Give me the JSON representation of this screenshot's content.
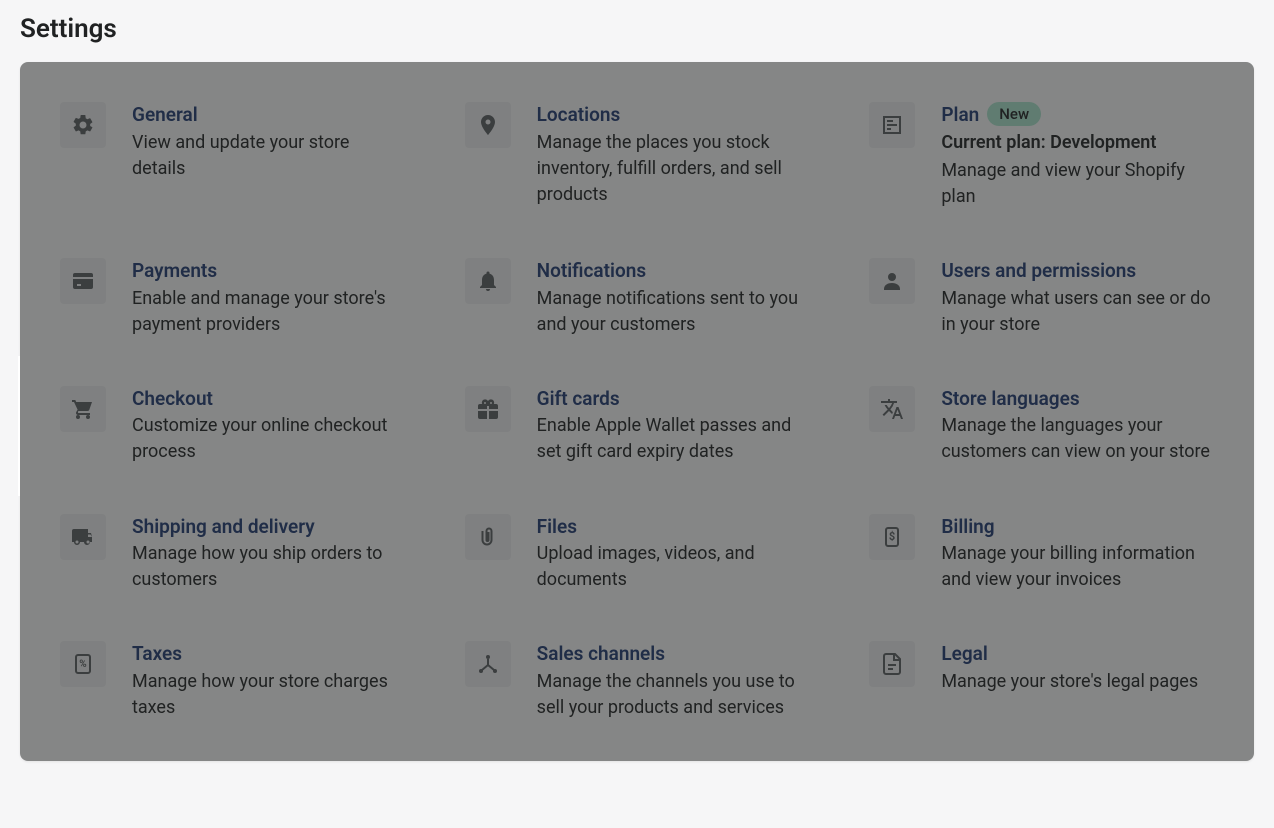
{
  "pageTitle": "Settings",
  "highlightId": "checkout",
  "cards": [
    {
      "id": "general",
      "title": "General",
      "desc": "View and update your store details"
    },
    {
      "id": "locations",
      "title": "Locations",
      "desc": "Manage the places you stock inventory, fulfill orders, and sell products"
    },
    {
      "id": "plan",
      "title": "Plan",
      "badge": "New",
      "extra": "Current plan: Development",
      "desc": "Manage and view your Shopify plan"
    },
    {
      "id": "payments",
      "title": "Payments",
      "desc": "Enable and manage your store's payment providers"
    },
    {
      "id": "notifications",
      "title": "Notifications",
      "desc": "Manage notifications sent to you and your customers"
    },
    {
      "id": "users",
      "title": "Users and permissions",
      "desc": "Manage what users can see or do in your store"
    },
    {
      "id": "checkout",
      "title": "Checkout",
      "desc": "Customize your online checkout process"
    },
    {
      "id": "giftcards",
      "title": "Gift cards",
      "desc": "Enable Apple Wallet passes and set gift card expiry dates"
    },
    {
      "id": "languages",
      "title": "Store languages",
      "desc": "Manage the languages your customers can view on your store"
    },
    {
      "id": "shipping",
      "title": "Shipping and delivery",
      "desc": "Manage how you ship orders to customers"
    },
    {
      "id": "files",
      "title": "Files",
      "desc": "Upload images, videos, and documents"
    },
    {
      "id": "billing",
      "title": "Billing",
      "desc": "Manage your billing information and view your invoices"
    },
    {
      "id": "taxes",
      "title": "Taxes",
      "desc": "Manage how your store charges taxes"
    },
    {
      "id": "saleschannels",
      "title": "Sales channels",
      "desc": "Manage the channels you use to sell your products and services"
    },
    {
      "id": "legal",
      "title": "Legal",
      "desc": "Manage your store's legal pages"
    }
  ]
}
